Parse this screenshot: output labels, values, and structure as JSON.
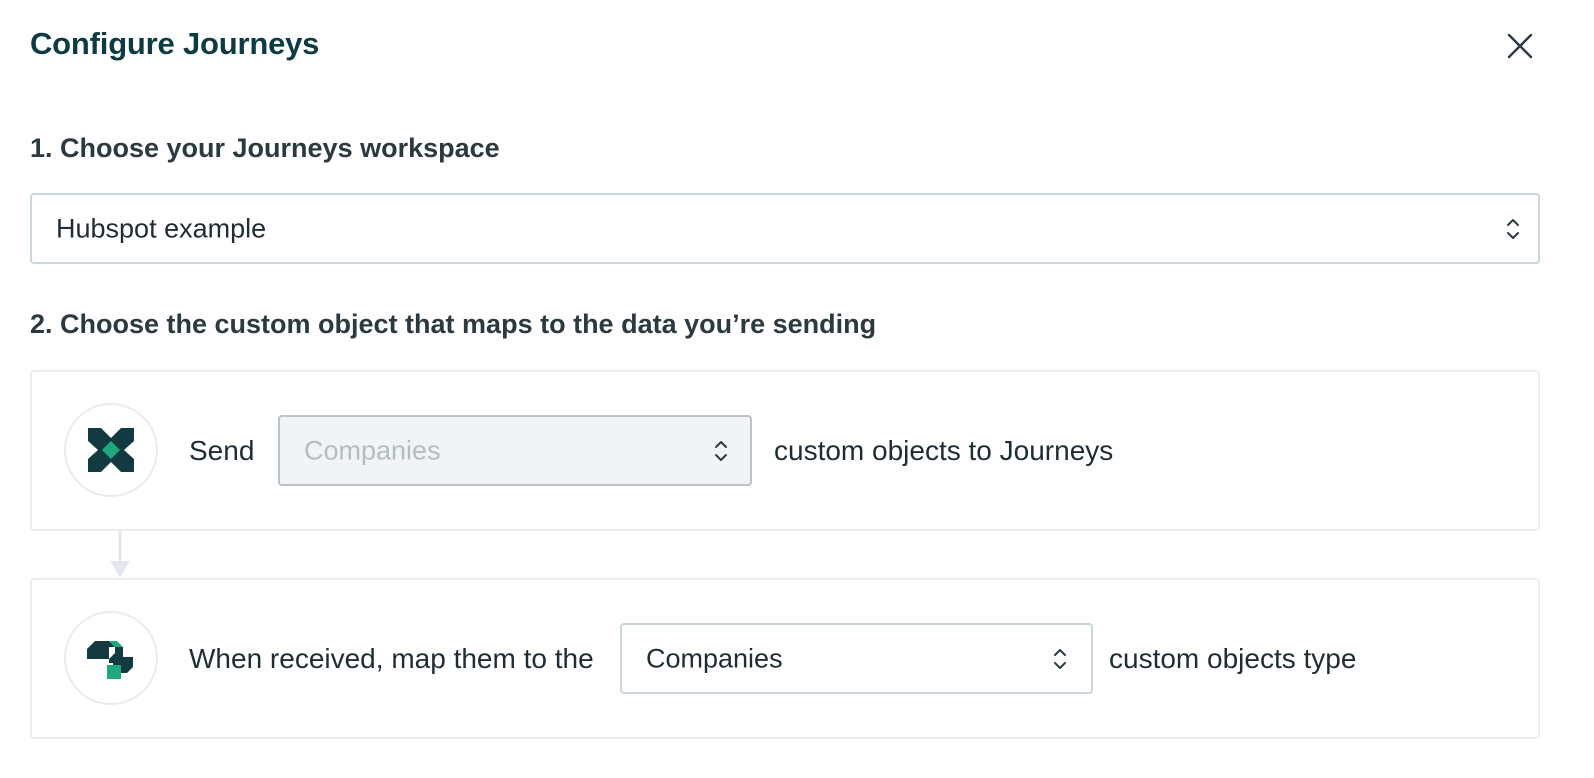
{
  "modal": {
    "title": "Configure Journeys",
    "close_icon": "close-icon"
  },
  "step1": {
    "heading": "1. Choose your Journeys workspace",
    "workspace_select": {
      "value": "Hubspot example",
      "icon": "chevron-up-down-icon"
    }
  },
  "step2": {
    "heading": "2. Choose the custom object that maps to the data you’re sending",
    "source_row": {
      "logo": "hubspot-x-logo-icon",
      "prefix": "Send",
      "select_placeholder": "Companies",
      "select_disabled": true,
      "suffix": "custom objects to Journeys"
    },
    "connector_icon": "arrow-down-icon",
    "target_row": {
      "logo": "journeys-logo-icon",
      "prefix": "When received, map them to the",
      "select_value": "Companies",
      "suffix": "custom objects type"
    }
  },
  "colors": {
    "title": "#0e3b43",
    "logo_dark": "#123a40",
    "logo_green": "#1fa77f",
    "border": "#c9d6dc",
    "disabled_bg": "#f1f4f5"
  }
}
